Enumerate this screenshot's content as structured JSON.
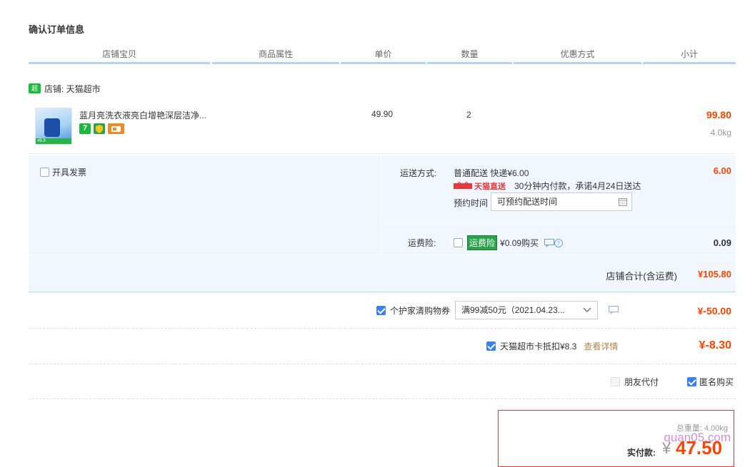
{
  "page_title": "确认订单信息",
  "columns": [
    "店铺宝贝",
    "商品属性",
    "单价",
    "数量",
    "优惠方式",
    "小计"
  ],
  "shop": {
    "logo_text": "超市",
    "label": "店铺: 天猫超市"
  },
  "item": {
    "name": "蓝月亮洗衣液亮白增艳深层洁净...",
    "thumb_price": "49.9",
    "price": "49.90",
    "quantity": "2",
    "subtotal": "99.80",
    "weight": "4.0kg",
    "badges": [
      "7",
      "shield",
      "card"
    ]
  },
  "invoice": {
    "label": "开具发票"
  },
  "shipping": {
    "label": "运送方式:",
    "method": "普通配送 快递¥6.00",
    "brand": "天猫直送",
    "note": "30分钟内付款，承诺4月24日送达",
    "schedule_label": "预约时间",
    "schedule_placeholder": "可预约配送时间",
    "fee": "6.00"
  },
  "insurance": {
    "label": "运费险:",
    "tag": "运费险",
    "price_text": "¥0.09购买",
    "fee": "0.09"
  },
  "shop_total": {
    "label": "店铺合计(含运费)",
    "value": "¥105.80"
  },
  "coupon": {
    "label": "个护家清购物券",
    "selected": "满99减50元（2021.04.23...",
    "value": "¥-50.00"
  },
  "card": {
    "label": "天猫超市卡抵扣¥8.3",
    "link": "查看详情",
    "value": "¥-8.30"
  },
  "options": {
    "friend_pay": "朋友代付",
    "anonymous": "匿名购买"
  },
  "summary": {
    "weight_label": "总重量: 4.00kg",
    "pay_label": "实付款:",
    "currency": "¥",
    "amount": "47.50",
    "watermark": "quan05.com"
  },
  "colors": {
    "accent_red": "#ff4400",
    "brand_blue": "#3a7ff6",
    "panel_bg": "#f2f7ff",
    "tmall_green": "#1aba3c"
  }
}
